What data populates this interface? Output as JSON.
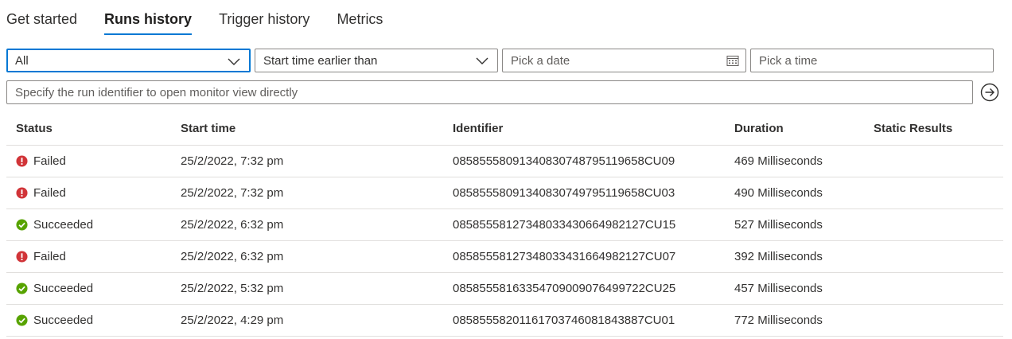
{
  "tabs": [
    {
      "label": "Get started"
    },
    {
      "label": "Runs history"
    },
    {
      "label": "Trigger history"
    },
    {
      "label": "Metrics"
    }
  ],
  "filters": {
    "status_value": "All",
    "time_filter_value": "Start time earlier than",
    "date_placeholder": "Pick a date",
    "time_placeholder": "Pick a time",
    "run_id_placeholder": "Specify the run identifier to open monitor view directly"
  },
  "table": {
    "headers": {
      "status": "Status",
      "start_time": "Start time",
      "identifier": "Identifier",
      "duration": "Duration",
      "static_results": "Static Results"
    },
    "rows": [
      {
        "status": "Failed",
        "start_time": "25/2/2022, 7:32 pm",
        "identifier": "08585558091340830748795119658CU09",
        "duration": "469 Milliseconds",
        "static_results": ""
      },
      {
        "status": "Failed",
        "start_time": "25/2/2022, 7:32 pm",
        "identifier": "08585558091340830749795119658CU03",
        "duration": "490 Milliseconds",
        "static_results": ""
      },
      {
        "status": "Succeeded",
        "start_time": "25/2/2022, 6:32 pm",
        "identifier": "08585558127348033430664982127CU15",
        "duration": "527 Milliseconds",
        "static_results": ""
      },
      {
        "status": "Failed",
        "start_time": "25/2/2022, 6:32 pm",
        "identifier": "08585558127348033431664982127CU07",
        "duration": "392 Milliseconds",
        "static_results": ""
      },
      {
        "status": "Succeeded",
        "start_time": "25/2/2022, 5:32 pm",
        "identifier": "08585558163354709009076499722CU25",
        "duration": "457 Milliseconds",
        "static_results": ""
      },
      {
        "status": "Succeeded",
        "start_time": "25/2/2022, 4:29 pm",
        "identifier": "08585558201161703746081843887CU01",
        "duration": "772 Milliseconds",
        "static_results": ""
      }
    ]
  },
  "colors": {
    "accent": "#0078d4",
    "failed": "#d13438",
    "succeeded": "#57a300"
  },
  "icons": {
    "failed": "error-circle-icon",
    "succeeded": "checkmark-circle-icon",
    "go": "arrow-right-circle-icon",
    "calendar": "calendar-icon",
    "dropdown": "chevron-down-icon"
  }
}
